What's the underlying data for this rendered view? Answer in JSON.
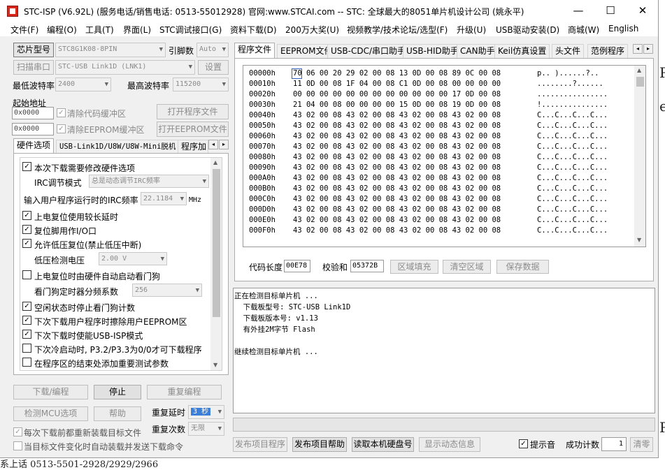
{
  "window": {
    "title": "STC-ISP (V6.92L) (服务电话/销售电话: 0513-55012928) 官网:www.STCAI.com  -- STC: 全球最大的8051单片机设计公司 (姚永平)",
    "min_icon": "—",
    "max_icon": "☐",
    "close_icon": "✕"
  },
  "background_peek": {
    "lines": [
      "P",
      "er",
      "P",
      "P"
    ],
    "bottom": "系上话   0513-5501-2928/2929/2966"
  },
  "menu": [
    "文件(F)",
    "编程(O)",
    "工具(T)",
    "界面(L)",
    "STC调试接口(G)",
    "资料下载(D)",
    "200万大奖(U)",
    "视频教学/技术论坛/选型(F)",
    "升级(U)",
    "USB驱动安装(D)",
    "商城(W)",
    "English"
  ],
  "left": {
    "chip_btn": "芯片型号",
    "chip_value": "STC8G1K08-8PIN",
    "pin_label": "引脚数",
    "pin_value": "Auto",
    "scan_btn": "扫描串口",
    "port_value": "STC-USB Link1D (LNK1)",
    "settings_btn": "设置",
    "min_baud_label": "最低波特率",
    "min_baud_value": "2400",
    "max_baud_label": "最高波特率",
    "max_baud_value": "115200",
    "start_addr_label": "起始地址",
    "addr1": "0x0000",
    "clear_code": "清除代码缓冲区",
    "open_prog": "打开程序文件",
    "addr2": "0x0000",
    "clear_eeprom": "清除EEPROM缓冲区",
    "open_eeprom": "打开EEPROM文件",
    "tabs": [
      "硬件选项",
      "USB-Link1D/U8W/U8W-Mini脱机",
      "程序加"
    ],
    "tab_left": "◂",
    "tab_right": "▸",
    "opt_header": "本次下载需要修改硬件选项",
    "irc_mode_label": "IRC调节模式",
    "irc_mode_value": "总是动态调节IRC频率",
    "irc_freq_label": "输入用户程序运行时的IRC频率",
    "irc_freq_value": "22.1184",
    "irc_unit": "MHz",
    "opt_poweron_delay": "上电复位使用较长延时",
    "opt_reset_io": "复位脚用作I/O口",
    "opt_lvr": "允许低压复位(禁止低压中断)",
    "lvd_label": "低压检测电压",
    "lvd_value": "2.00 V",
    "opt_wdt_auto": "上电复位时由硬件自动启动看门狗",
    "wdt_div_label": "看门狗定时器分频系数",
    "wdt_div_value": "256",
    "opt_idle_wdt": "空闲状态时停止看门狗计数",
    "opt_erase_eeprom": "下次下载用户程序时擦除用户EEPROM区",
    "opt_usb_isp": "下次下载时使能USB-ISP模式",
    "opt_cold_boot": "下次冷启动时, P3.2/P3.3为0/0才可下载程序",
    "opt_test_param": "在程序区的结束处添加重要测试参数",
    "download_btn": "下载/编程",
    "stop_btn": "停止",
    "reprog_btn": "重复编程",
    "detect_btn": "检测MCU选项",
    "help_btn": "帮助",
    "repeat_delay_label": "重复延时",
    "repeat_delay_value": "3 秒",
    "repeat_count_label": "重复次数",
    "repeat_count_value": "无限",
    "reload_label": "每次下载前都重新装载目标文件",
    "autoload_label": "当目标文件变化时自动装载并发送下载命令"
  },
  "right": {
    "tabs": [
      "程序文件",
      "EEPROM文件",
      "USB-CDC/串口助手",
      "USB-HID助手",
      "CAN助手",
      "Keil仿真设置",
      "头文件",
      "范例程序"
    ],
    "tab_left": "◂",
    "tab_right": "▸",
    "hex_rows": [
      {
        "addr": "00000h",
        "bytes": "70 06 00 20 29 02 00 08 13 0D 00 08 89 0C 00 08",
        "ascii": "p.. )......?.."
      },
      {
        "addr": "00010h",
        "bytes": "11 0D 00 08 1F 04 00 08 C1 0D 00 08 00 00 00 00",
        "ascii": "........?......"
      },
      {
        "addr": "00020h",
        "bytes": "00 00 00 00 00 00 00 00 00 00 00 00 17 0D 00 08",
        "ascii": "................"
      },
      {
        "addr": "00030h",
        "bytes": "21 04 00 08 00 00 00 00 15 0D 00 08 19 0D 00 08",
        "ascii": "!..............."
      },
      {
        "addr": "00040h",
        "bytes": "43 02 00 08 43 02 00 08 43 02 00 08 43 02 00 08",
        "ascii": "C...C...C...C..."
      },
      {
        "addr": "00050h",
        "bytes": "43 02 00 08 43 02 00 08 43 02 00 08 43 02 00 08",
        "ascii": "C...C...C...C..."
      },
      {
        "addr": "00060h",
        "bytes": "43 02 00 08 43 02 00 08 43 02 00 08 43 02 00 08",
        "ascii": "C...C...C...C..."
      },
      {
        "addr": "00070h",
        "bytes": "43 02 00 08 43 02 00 08 43 02 00 08 43 02 00 08",
        "ascii": "C...C...C...C..."
      },
      {
        "addr": "00080h",
        "bytes": "43 02 00 08 43 02 00 08 43 02 00 08 43 02 00 08",
        "ascii": "C...C...C...C..."
      },
      {
        "addr": "00090h",
        "bytes": "43 02 00 08 43 02 00 08 43 02 00 08 43 02 00 08",
        "ascii": "C...C...C...C..."
      },
      {
        "addr": "000A0h",
        "bytes": "43 02 00 08 43 02 00 08 43 02 00 08 43 02 00 08",
        "ascii": "C...C...C...C..."
      },
      {
        "addr": "000B0h",
        "bytes": "43 02 00 08 43 02 00 08 43 02 00 08 43 02 00 08",
        "ascii": "C...C...C...C..."
      },
      {
        "addr": "000C0h",
        "bytes": "43 02 00 08 43 02 00 08 43 02 00 08 43 02 00 08",
        "ascii": "C...C...C...C..."
      },
      {
        "addr": "000D0h",
        "bytes": "43 02 00 08 43 02 00 08 43 02 00 08 43 02 00 08",
        "ascii": "C...C...C...C..."
      },
      {
        "addr": "000E0h",
        "bytes": "43 02 00 08 43 02 00 08 43 02 00 08 43 02 00 08",
        "ascii": "C...C...C...C..."
      },
      {
        "addr": "000F0h",
        "bytes": "43 02 00 08 43 02 00 08 43 02 00 08 43 02 00 08",
        "ascii": "C...C...C...C..."
      }
    ],
    "code_len_label": "代码长度",
    "code_len_value": "00E78",
    "checksum_label": "校验和",
    "checksum_value": "05372B",
    "fill_btn": "区域填充",
    "clear_btn": "清空区域",
    "save_btn": "保存数据",
    "log_lines": [
      "正在检测目标单片机 ...",
      "  下载板型号: STC-USB Link1D",
      "  下载板版本号: v1.13",
      "  有外挂2M字节 Flash",
      "",
      "继续检测目标单片机 ..."
    ],
    "publish_prog_btn": "发布项目程序",
    "publish_help_btn": "发布项目帮助",
    "read_disk_btn": "读取本机硬盘号",
    "show_dyn_btn": "显示动态信息",
    "beep_label": "提示音",
    "success_label": "成功计数",
    "success_value": "1",
    "clear_count_btn": "清零"
  }
}
